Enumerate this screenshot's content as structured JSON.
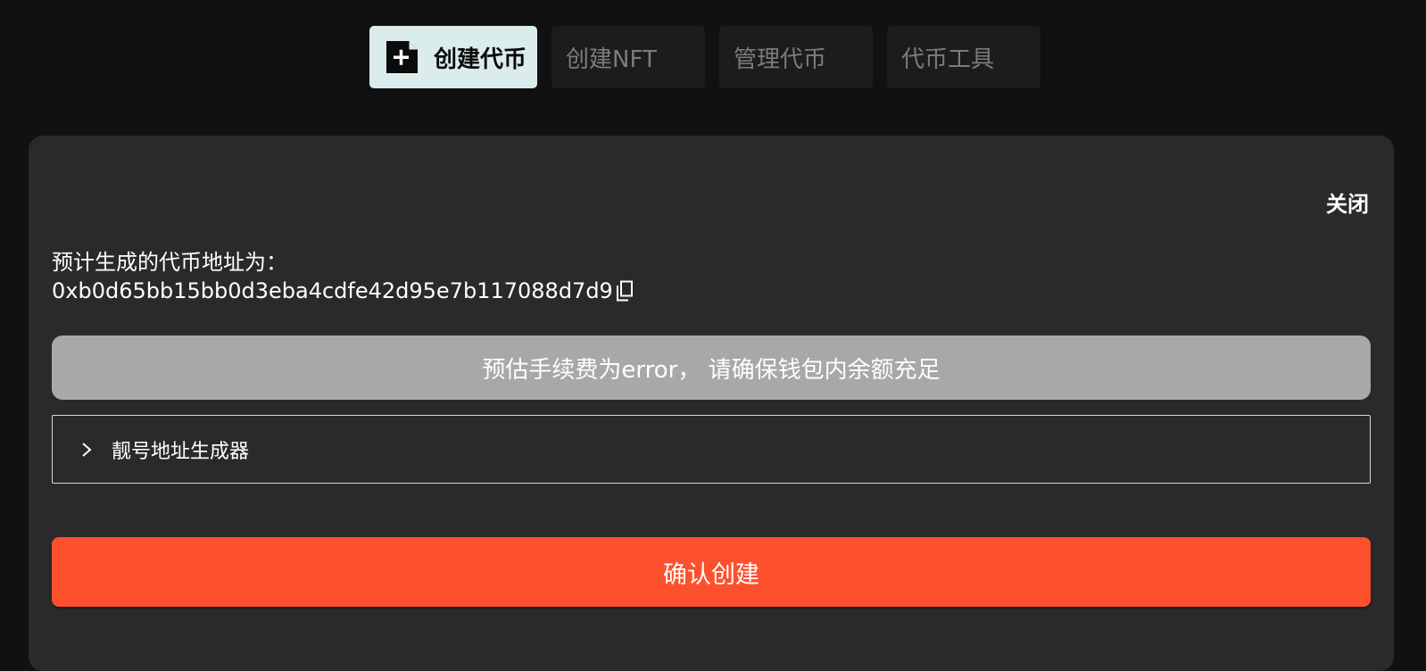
{
  "tabs": [
    {
      "label": "创建代币",
      "active": true,
      "icon": "add-file-icon"
    },
    {
      "label": "创建NFT",
      "active": false
    },
    {
      "label": "管理代币",
      "active": false
    },
    {
      "label": "代币工具",
      "active": false
    }
  ],
  "panel": {
    "close_label": "关闭",
    "address_label": "预计生成的代币地址为：",
    "address_value": "0xb0d65bb15bb0d3eba4cdfe42d95e7b117088d7d9",
    "copy_icon": "copy-icon",
    "fee_text": "预估手续费为error， 请确保钱包内余额充足",
    "accordion_label": "靓号地址生成器",
    "accordion_icon": "chevron-right-icon",
    "confirm_label": "确认创建"
  },
  "colors": {
    "background": "#111111",
    "panel": "#2a2a2a",
    "active_tab": "#daeceb",
    "inactive_tab": "#1c1c1c",
    "fee_bar": "#a8a8a8",
    "confirm": "#fd502d"
  }
}
